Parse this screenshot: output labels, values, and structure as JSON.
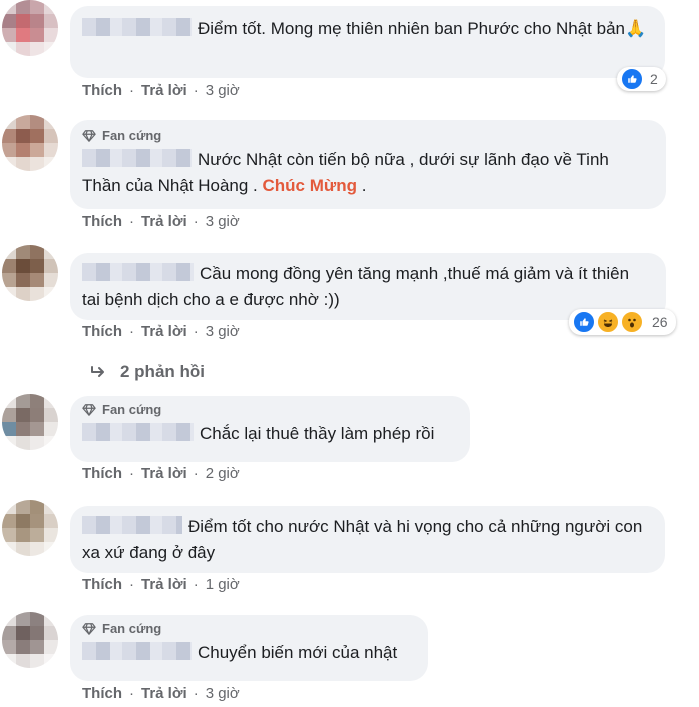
{
  "badge_label": "Fan cứng",
  "actions": {
    "like": "Thích",
    "reply": "Trả lời",
    "sep": "·"
  },
  "comments": [
    {
      "text": "Điểm tốt. Mong mẹ thiên nhiên ban Phước cho Nhật bản🙏",
      "time": "3 giờ",
      "reaction_count": "2"
    },
    {
      "text_a": "Nước Nhật còn tiến bộ nữa , dưới sự lãnh đạo về Tinh Thần của Nhật Hoàng .",
      "text_hl": "Chúc Mừng",
      "text_b": ".",
      "time": "3 giờ"
    },
    {
      "text": "Cầu mong đồng yên tăng mạnh ,thuế má giảm và ít thiên tai bệnh dịch cho a e được nhờ :))",
      "time": "3 giờ",
      "reaction_count": "26"
    },
    {
      "text": "Chắc lại thuê thầy làm phép rồi",
      "time": "2 giờ"
    },
    {
      "text": "Điểm tốt cho nước Nhật và hi vọng cho cả những người con xa xứ đang ở đây",
      "time": "1 giờ"
    },
    {
      "text": "Chuyển biến mới của nhật",
      "time": "3 giờ"
    }
  ],
  "replies_label": "2 phản hồi",
  "colors": {
    "like_blue": "#1877f2",
    "highlight": "#e35a3c",
    "bubble_bg": "#f0f2f5",
    "meta": "#65676b"
  }
}
